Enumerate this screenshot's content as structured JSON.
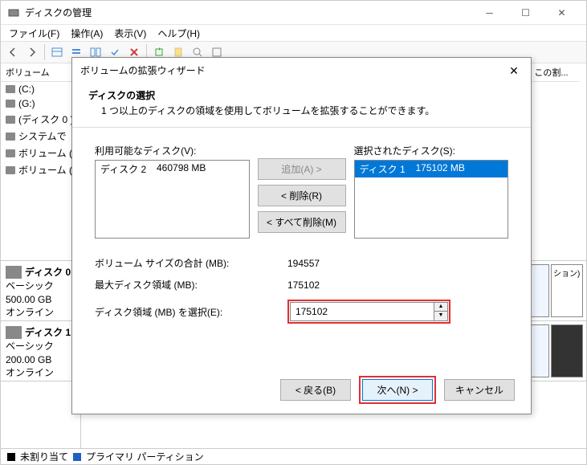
{
  "window": {
    "title": "ディスクの管理",
    "menu": {
      "file": "ファイル(F)",
      "action": "操作(A)",
      "view": "表示(V)",
      "help": "ヘルプ(H)"
    },
    "col_volume": "ボリューム",
    "col_other": "この割..."
  },
  "volumes": [
    "(C:)",
    "(G:)",
    "(ディスク 0 )",
    "システムで",
    "ボリューム (",
    "ボリューム ("
  ],
  "disks": [
    {
      "name": "ディスク 0",
      "type": "ベーシック",
      "size": "500.00 GB",
      "status": "オンライン"
    },
    {
      "name": "ディスク 1",
      "type": "ベーシック",
      "size": "200.00 GB",
      "status": "オンライン"
    }
  ],
  "legend": {
    "unalloc": "未割り当て",
    "primary": "プライマリ パーティション"
  },
  "dialog": {
    "title": "ボリュームの拡張ウィザード",
    "heading": "ディスクの選択",
    "sub": "1 つ以上のディスクの領域を使用してボリュームを拡張することができます。",
    "avail_label": "利用可能なディスク(V):",
    "sel_label": "選択されたディスク(S):",
    "avail_item_name": "ディスク 2",
    "avail_item_size": "460798 MB",
    "sel_item_name": "ディスク 1",
    "sel_item_size": "175102 MB",
    "btn_add": "追加(A) >",
    "btn_remove": "< 削除(R)",
    "btn_remove_all": "< すべて削除(M)",
    "field_total": "ボリューム サイズの合計 (MB):",
    "field_max": "最大ディスク領域 (MB):",
    "field_select": "ディスク領域 (MB) を選択(E):",
    "val_total": "194557",
    "val_max": "175102",
    "val_select": "175102",
    "btn_back": "< 戻る(B)",
    "btn_next": "次へ(N) >",
    "btn_cancel": "キャンセル"
  }
}
